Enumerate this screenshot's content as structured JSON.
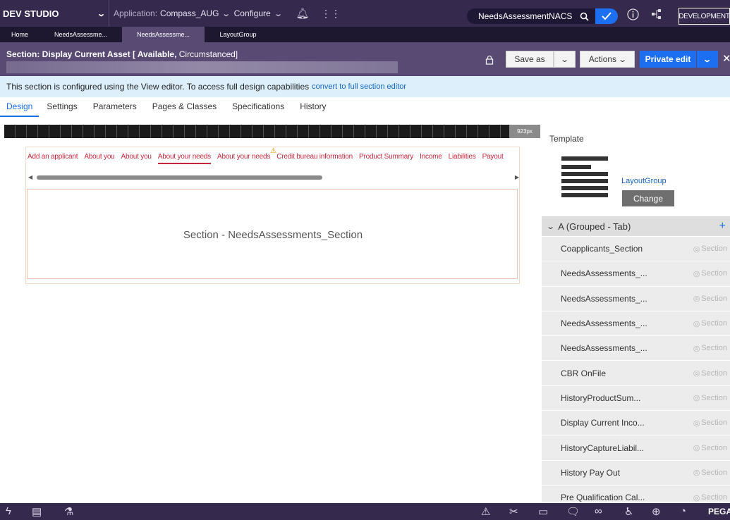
{
  "topbar": {
    "brand": "DEV STUDIO",
    "application_label": "Application:",
    "application_value": "Compass_AUG",
    "configure_label": "Configure",
    "search_value": "NeedsAssessmentNACS",
    "environment_badge": "DEVELOPMENT"
  },
  "doc_tabs": [
    {
      "label": "Home"
    },
    {
      "label": "NeedsAssessme..."
    },
    {
      "label": "NeedsAssessme..."
    },
    {
      "label": "LayoutGroup"
    }
  ],
  "header": {
    "title_prefix": "Section: Display Current Asset",
    "title_status": "[ Available,",
    "title_suffix": "Circumstanced]",
    "save_as_label": "Save as",
    "actions_label": "Actions",
    "private_edit_label": "Private edit"
  },
  "info": {
    "message": "This section is configured using the View editor. To access full design capabilities",
    "link": "convert to full section editor"
  },
  "rule_tabs": [
    {
      "label": "Design"
    },
    {
      "label": "Settings"
    },
    {
      "label": "Parameters"
    },
    {
      "label": "Pages & Classes"
    },
    {
      "label": "Specifications"
    },
    {
      "label": "History"
    }
  ],
  "canvas": {
    "ruler_label": "923px",
    "nav_tabs": [
      {
        "label": "Add an applicant"
      },
      {
        "label": "About you"
      },
      {
        "label": "About you"
      },
      {
        "label": "About your needs"
      },
      {
        "label": "About your needs"
      },
      {
        "label": "Credit bureau information"
      },
      {
        "label": "Product Summary"
      },
      {
        "label": "Income"
      },
      {
        "label": "Liabilities"
      },
      {
        "label": "Payout"
      }
    ],
    "section_label": "Section - NeedsAssessments_Section"
  },
  "right_panel": {
    "template_title": "Template",
    "template_name": "LayoutGroup",
    "change_label": "Change",
    "group_title": "A (Grouped - Tab)",
    "items": [
      {
        "name": "Coapplicants_Section",
        "type": "Section"
      },
      {
        "name": "NeedsAssessments_...",
        "type": "Section"
      },
      {
        "name": "NeedsAssessments_...",
        "type": "Section"
      },
      {
        "name": "NeedsAssessments_...",
        "type": "Section"
      },
      {
        "name": "NeedsAssessments_...",
        "type": "Section"
      },
      {
        "name": "CBR OnFile",
        "type": "Section"
      },
      {
        "name": "HistoryProductSum...",
        "type": "Section"
      },
      {
        "name": "Display Current Inco...",
        "type": "Section"
      },
      {
        "name": "HistoryCaptureLiabil...",
        "type": "Section"
      },
      {
        "name": "History Pay Out",
        "type": "Section"
      },
      {
        "name": "Pre Qualification Cal...",
        "type": "Section"
      }
    ]
  },
  "bottombar": {
    "brand": "PEGA"
  },
  "colors": {
    "header_purple": "#352a4e",
    "primary_blue": "#1b6ff0",
    "nav_red": "#c4273c"
  }
}
